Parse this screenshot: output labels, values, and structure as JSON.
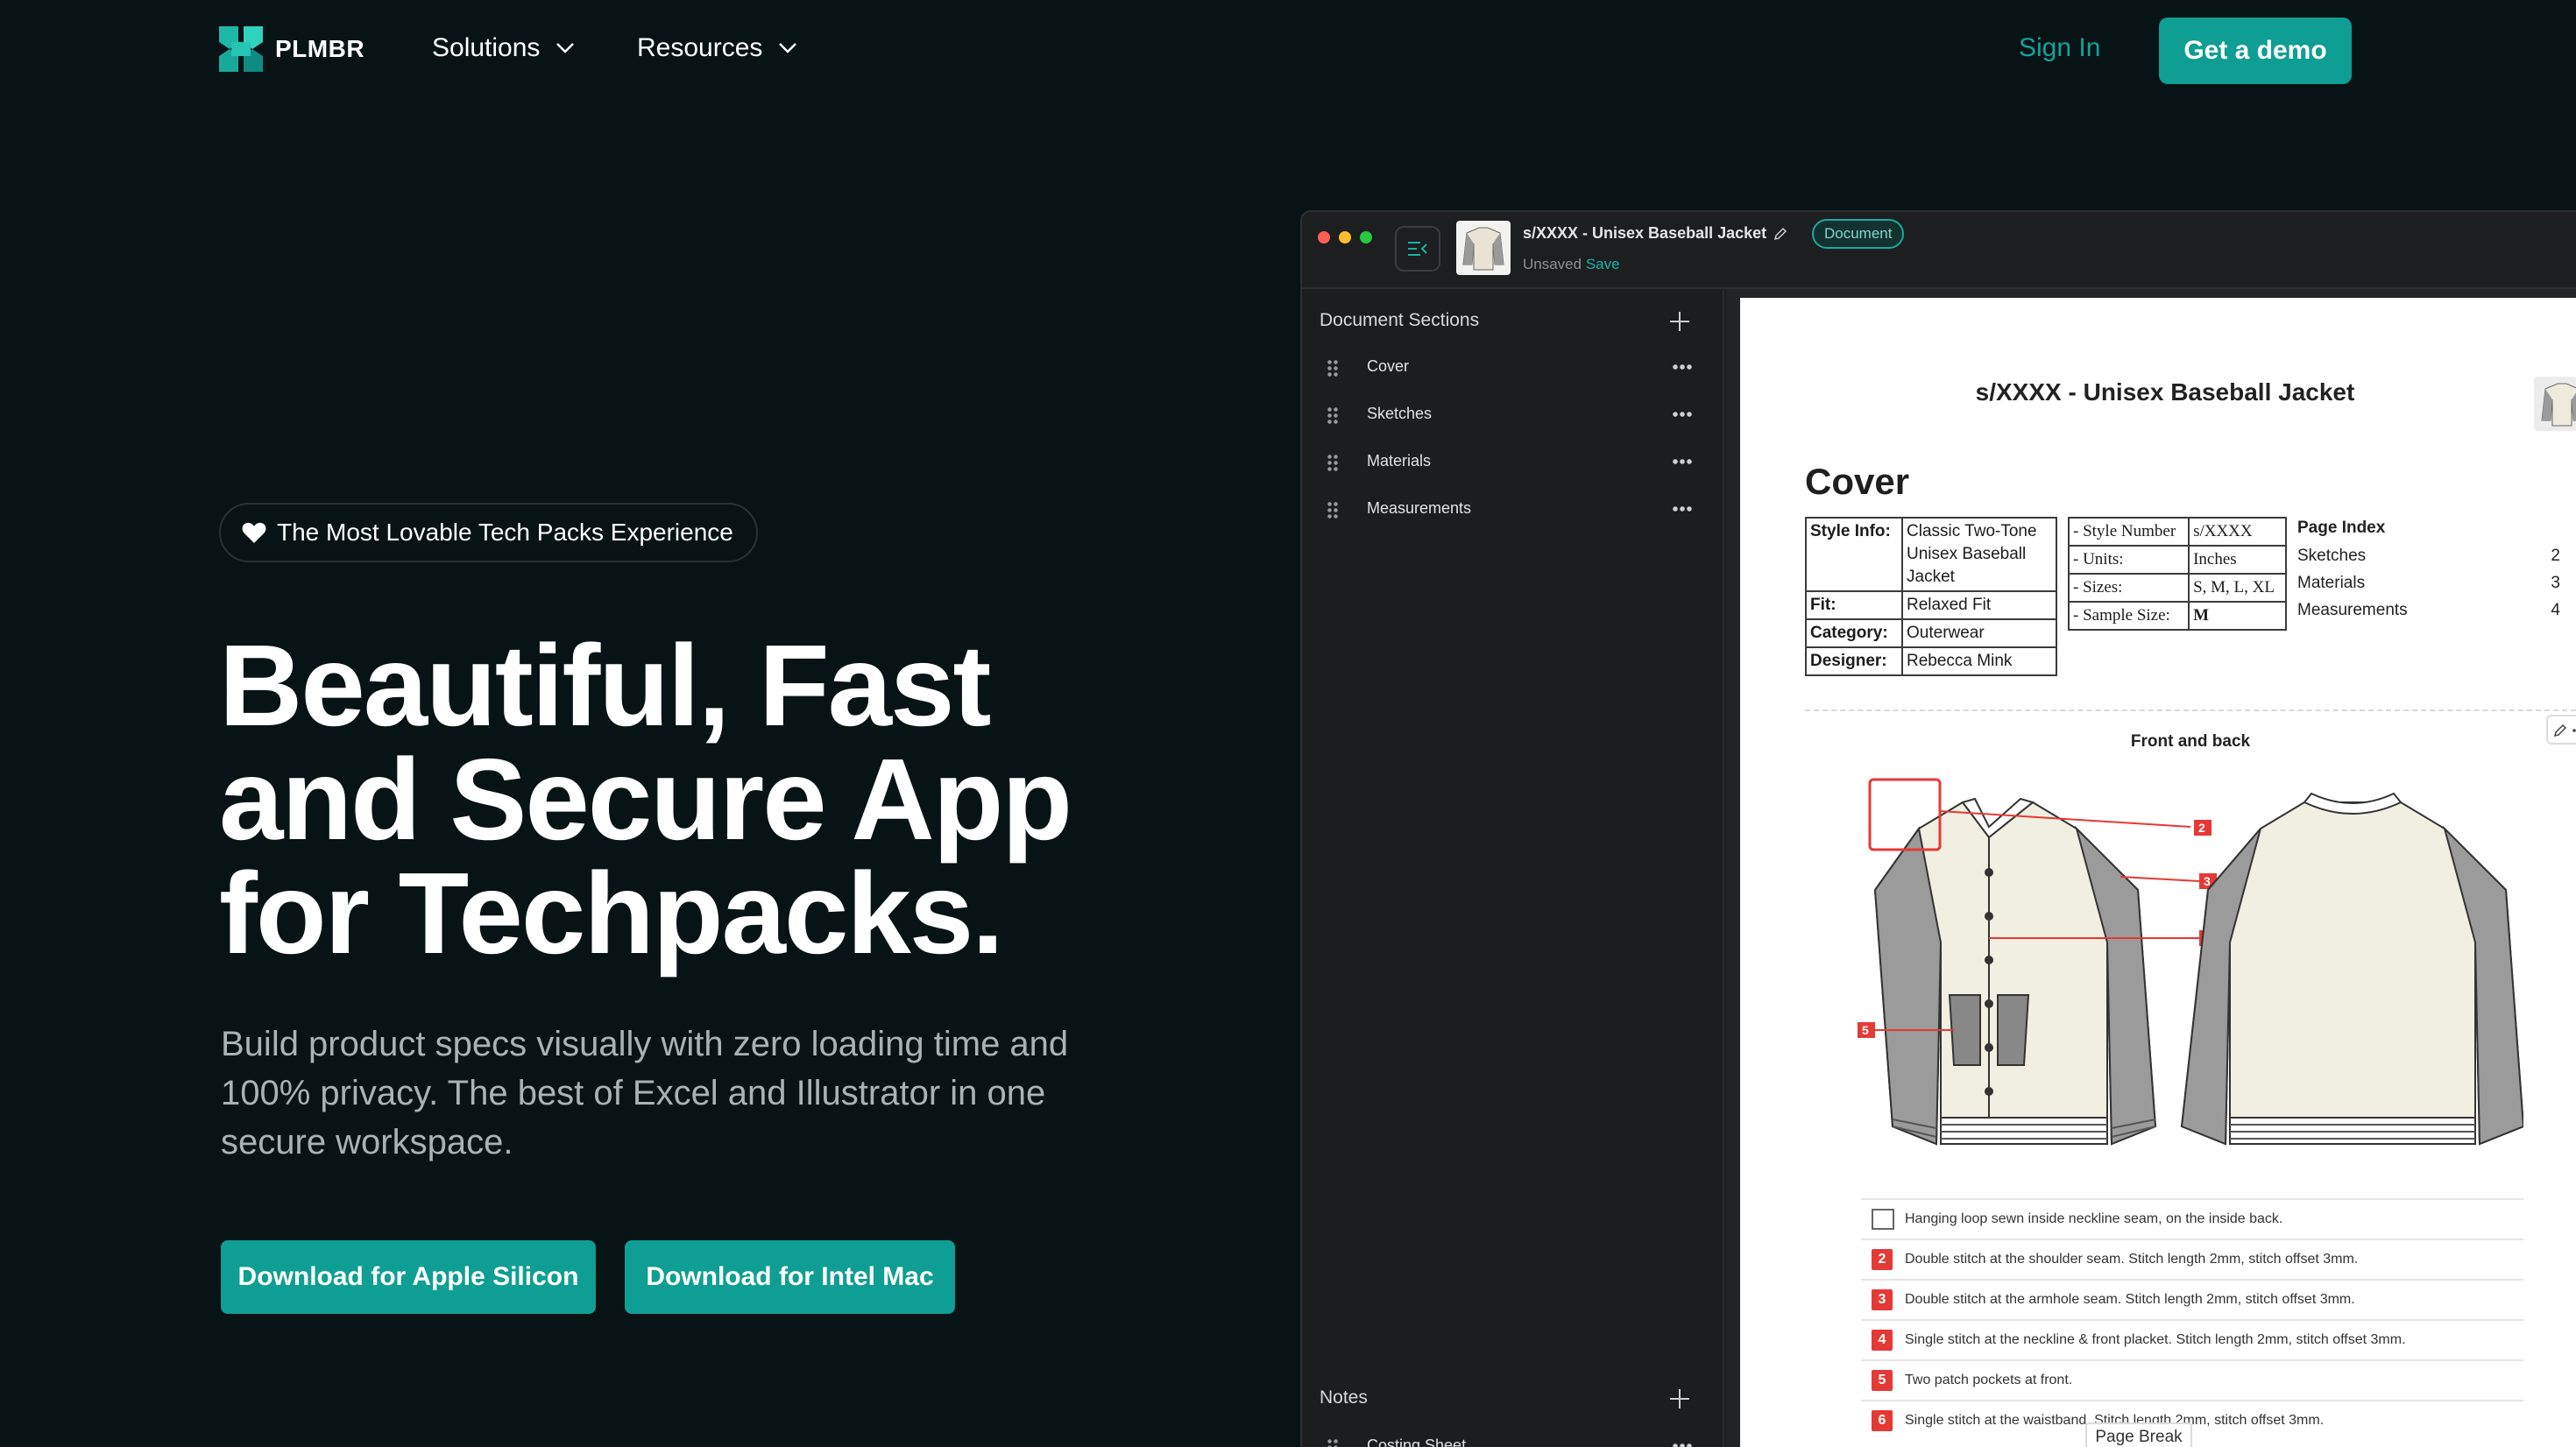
{
  "nav": {
    "brand": "PLMBR",
    "links": [
      {
        "label": "Solutions"
      },
      {
        "label": "Resources"
      }
    ],
    "sign_in": "Sign In",
    "cta": "Get a demo"
  },
  "hero": {
    "badge": "The Most Lovable Tech Packs Experience",
    "headline": [
      "Beautiful, Fast",
      "and Secure App",
      "for Techpacks."
    ],
    "subtitle": "Build product specs visually with zero loading time and 100% privacy. The best of Excel and Illustrator in one secure workspace.",
    "buttons": {
      "apple": "Download for Apple Silicon",
      "intel": "Download for Intel Mac"
    }
  },
  "app": {
    "doc_title": "s/XXXX - Unisex Baseball Jacket",
    "doc_badge": "Document",
    "status": "Unsaved",
    "save": "Save",
    "sidebar": {
      "sections_title": "Document Sections",
      "sections": [
        "Cover",
        "Sketches",
        "Materials",
        "Measurements"
      ],
      "notes_title": "Notes",
      "notes_items": [
        "Costing Sheet"
      ]
    },
    "page": {
      "title": "s/XXXX - Unisex Baseball Jacket",
      "section_heading": "Cover",
      "style_table": [
        {
          "k": "Style Info:",
          "v": "Classic Two-Tone Unisex Baseball Jacket"
        },
        {
          "k": "Fit:",
          "v": "Relaxed Fit"
        },
        {
          "k": "Category:",
          "v": "Outerwear"
        },
        {
          "k": "Designer:",
          "v": "Rebecca Mink"
        }
      ],
      "spec_table": [
        {
          "k": "- Style Number",
          "v": "s/XXXX"
        },
        {
          "k": "- Units:",
          "v": "Inches"
        },
        {
          "k": "- Sizes:",
          "v": "S, M, L, XL"
        },
        {
          "k": "- Sample Size:",
          "v": "M"
        }
      ],
      "page_index": {
        "title": "Page Index",
        "rows": [
          {
            "name": "Sketches",
            "page": "2"
          },
          {
            "name": "Materials",
            "page": "3"
          },
          {
            "name": "Measurements",
            "page": "4"
          }
        ]
      },
      "sketch_title": "Front and back",
      "callouts": [
        "2",
        "3",
        "4",
        "5",
        "6"
      ],
      "notes": [
        {
          "num": "",
          "text": "Hanging loop sewn inside neckline seam, on the inside back."
        },
        {
          "num": "2",
          "text": "Double stitch at the shoulder seam. Stitch length 2mm, stitch offset 3mm."
        },
        {
          "num": "3",
          "text": "Double stitch at the armhole seam. Stitch length 2mm, stitch offset 3mm."
        },
        {
          "num": "4",
          "text": "Single stitch at the neckline & front placket. Stitch length 2mm, stitch offset 3mm."
        },
        {
          "num": "5",
          "text": "Two patch pockets at front."
        },
        {
          "num": "6",
          "text": "Single stitch at the waistband. Stitch length 2mm, stitch offset 3mm."
        }
      ],
      "page_break": "Page Break"
    }
  },
  "colors": {
    "background": "#081316",
    "accent": "#0f9e93",
    "callout_red": "#e53935"
  }
}
